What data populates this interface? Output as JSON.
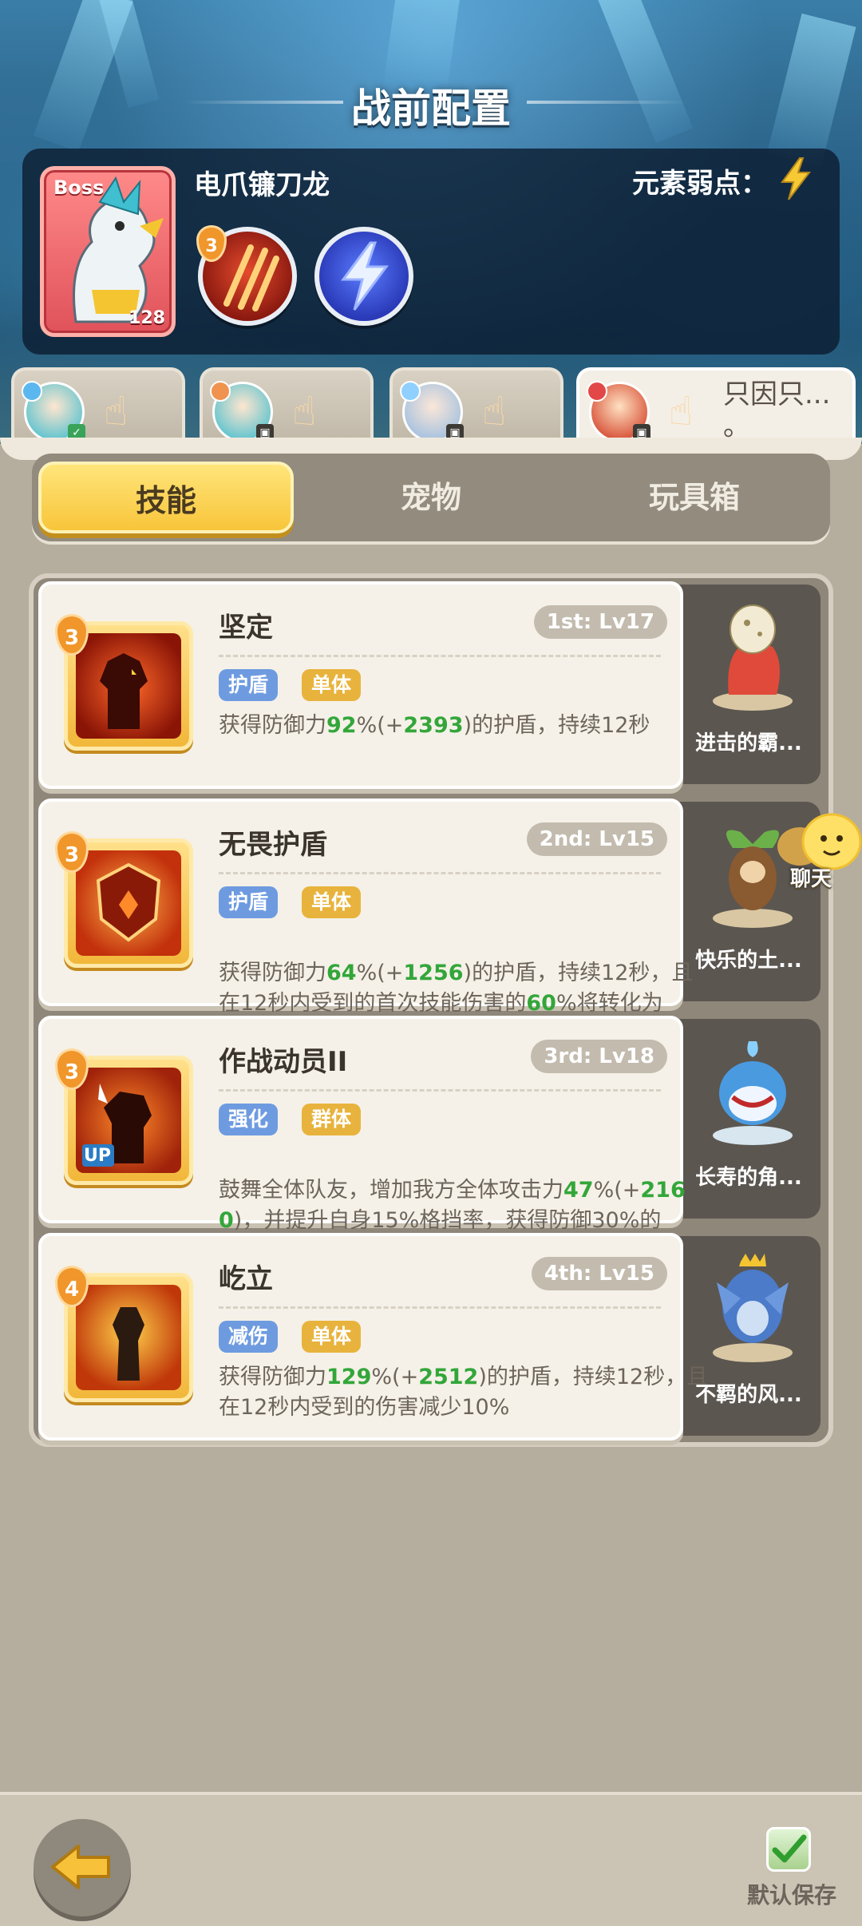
{
  "header": {
    "title": "战前配置",
    "boss": {
      "tag": "Boss",
      "level": "128",
      "name": "电爪镰刀龙",
      "weakness_label": "元素弱点：",
      "weakness_icon": "lightning-icon",
      "skill_orbs": [
        {
          "icon": "claw-slash-icon",
          "badge": "3"
        },
        {
          "icon": "lightning-orb-icon",
          "badge": ""
        }
      ]
    }
  },
  "hero_tabs": [
    {
      "name": "",
      "active": false
    },
    {
      "name": "",
      "active": false
    },
    {
      "name": "",
      "active": false
    },
    {
      "name": "只因只...\n。",
      "active": true
    }
  ],
  "segments": [
    {
      "label": "技能",
      "active": true
    },
    {
      "label": "宠物",
      "active": false
    },
    {
      "label": "玩具箱",
      "active": false
    }
  ],
  "skills": [
    {
      "level_badge": "3",
      "title": "坚定",
      "slot": "1st: Lv17",
      "tags": [
        "护盾",
        "单体"
      ],
      "desc_parts": [
        "获得防御力",
        "92",
        "%(+",
        "2393",
        ")的护盾，持续12秒"
      ],
      "pet_name": "进击的霸..."
    },
    {
      "level_badge": "3",
      "title": "无畏护盾",
      "slot": "2nd: Lv15",
      "tags": [
        "护盾",
        "单体"
      ],
      "desc_parts": [
        "获得防御力",
        "64",
        "%(+",
        "1256",
        ")的护盾，持续12秒，且在12秒内受到的首次技能伤害的",
        "60",
        "%将转化为\n..."
      ],
      "pet_name": "快乐的土..."
    },
    {
      "level_badge": "3",
      "title": "作战动员II",
      "slot": "3rd: Lv18",
      "tags": [
        "强化",
        "群体"
      ],
      "desc_parts": [
        "鼓舞全体队友，增加我方全体攻击力",
        "47",
        "%(+",
        "2160",
        ")，并提升自身15%格挡率，获得防御30%的\n..."
      ],
      "pet_name": "长寿的角..."
    },
    {
      "level_badge": "4",
      "title": "屹立",
      "slot": "4th: Lv15",
      "tags": [
        "减伤",
        "单体"
      ],
      "desc_parts": [
        "获得防御力",
        "129",
        "%(+",
        "2512",
        ")的护盾，持续12秒，且在12秒内受到的伤害减少10%"
      ],
      "pet_name": "不羁的风..."
    }
  ],
  "chat": {
    "label": "聊天"
  },
  "bottom": {
    "save_label": "默认保存",
    "save_checked": true
  },
  "colors": {
    "accent_yellow": "#f8c53a",
    "highlight_green": "#33a63a",
    "tag_blue": "#6e9be0",
    "tag_yellow": "#e8b33d"
  }
}
